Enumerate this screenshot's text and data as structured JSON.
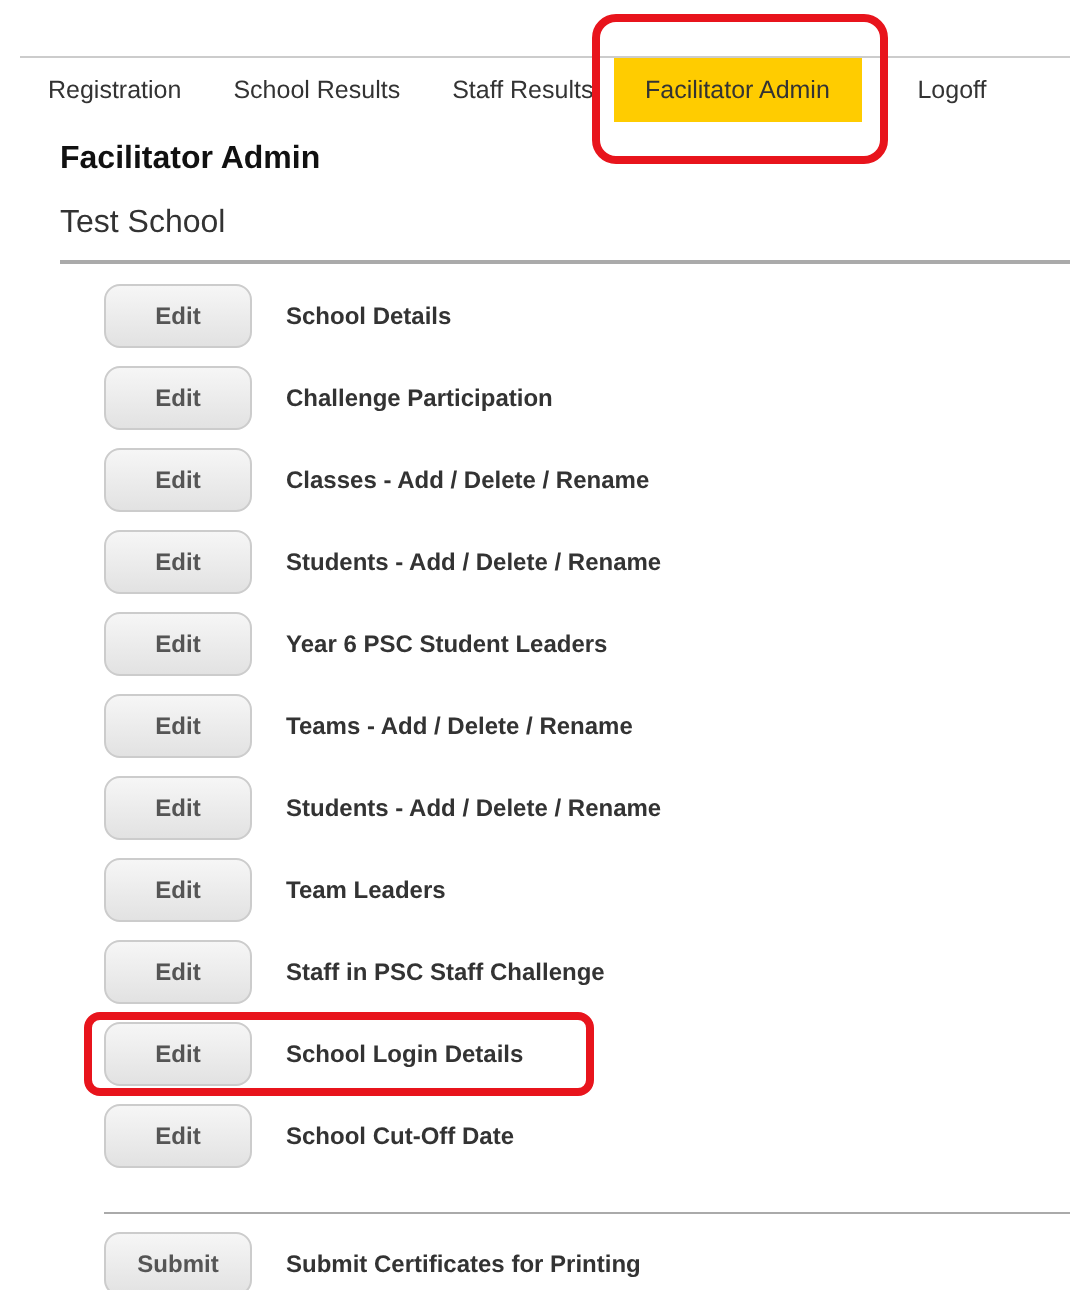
{
  "tabs": [
    {
      "label": "Registration",
      "selected": false,
      "highlighted": false
    },
    {
      "label": "School Results",
      "selected": false,
      "highlighted": false
    },
    {
      "label": "Staff Results",
      "selected": false,
      "highlighted": false
    },
    {
      "label": "Facilitator Admin",
      "selected": true,
      "highlighted": true
    },
    {
      "label": "Logoff",
      "selected": false,
      "highlighted": false
    }
  ],
  "heading": "Facilitator Admin",
  "school": "Test School",
  "rows": [
    {
      "button": "Edit",
      "label": "School Details",
      "highlighted": false
    },
    {
      "button": "Edit",
      "label": "Challenge Participation",
      "highlighted": false
    },
    {
      "button": "Edit",
      "label": "Classes - Add / Delete / Rename",
      "highlighted": false
    },
    {
      "button": "Edit",
      "label": "Students - Add / Delete / Rename",
      "highlighted": false
    },
    {
      "button": "Edit",
      "label": "Year 6 PSC Student Leaders",
      "highlighted": false
    },
    {
      "button": "Edit",
      "label": "Teams - Add / Delete / Rename",
      "highlighted": false
    },
    {
      "button": "Edit",
      "label": "Students - Add / Delete / Rename",
      "highlighted": false
    },
    {
      "button": "Edit",
      "label": "Team Leaders",
      "highlighted": false
    },
    {
      "button": "Edit",
      "label": "Staff in PSC Staff Challenge",
      "highlighted": false
    },
    {
      "button": "Edit",
      "label": "School Login Details",
      "highlighted": true
    },
    {
      "button": "Edit",
      "label": "School Cut-Off Date",
      "highlighted": false
    }
  ],
  "submit_row": {
    "button": "Submit",
    "label": "Submit Certificates for Printing"
  }
}
